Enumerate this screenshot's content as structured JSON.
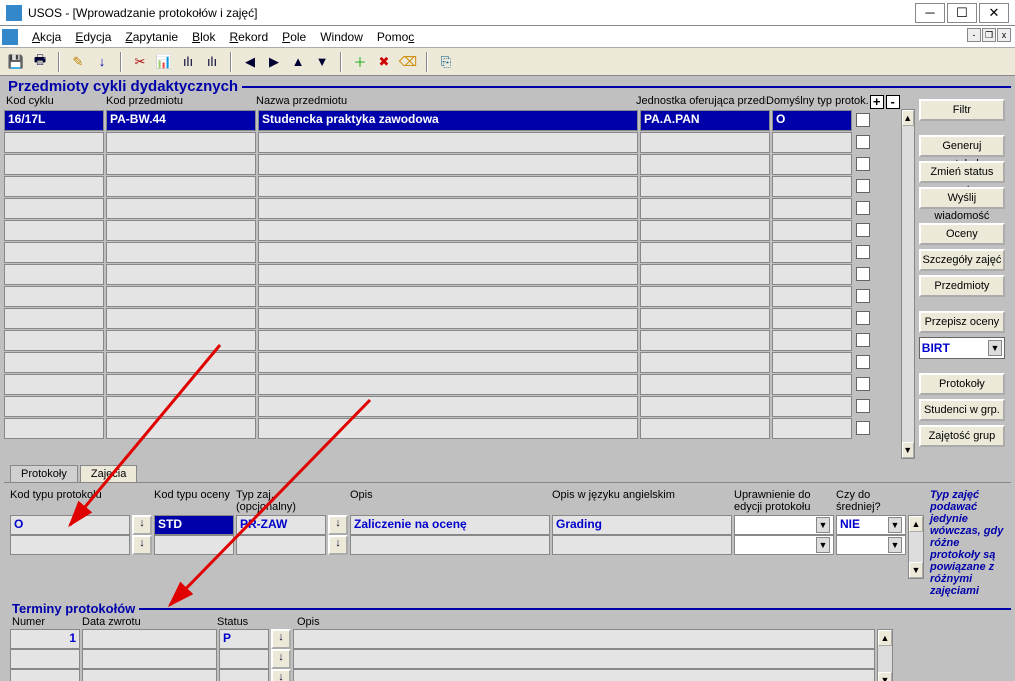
{
  "window": {
    "title": "USOS - [Wprowadzanie protokołów i zajęć]"
  },
  "menu": {
    "a1": "Akcja",
    "a2": "Edycja",
    "a3": "Zapytanie",
    "a4": "Blok",
    "a5": "Rekord",
    "a6": "Pole",
    "a7": "Window",
    "a8": "Pomoc"
  },
  "section1": {
    "title": "Przedmioty cykli dydaktycznych",
    "headers": {
      "c1": "Kod cyklu",
      "c2": "Kod przedmiotu",
      "c3": "Nazwa przedmiotu",
      "c4": "Jednostka oferująca przedm.",
      "c5": "Domyślny typ protok."
    },
    "row1": {
      "c1": "16/17L",
      "c2": "PA-BW.44",
      "c3": "Studencka praktyka zawodowa",
      "c4": "PA.A.PAN",
      "c5": "O"
    }
  },
  "buttons": {
    "b1": "Filtr",
    "b2": "Generuj protokoły",
    "b3": "Zmień status prot.",
    "b4": "Wyślij wiadomość",
    "b5": "Oceny",
    "b6": "Szczegóły zajęć",
    "b7": "Przedmioty",
    "b8": "Przepisz oceny",
    "sel": "BIRT",
    "b9": "Protokoły",
    "b10": "Studenci w grp.",
    "b11": "Zajętość grup"
  },
  "tabs": {
    "t1": "Protokoły",
    "t2": "Zajęcia"
  },
  "proto": {
    "h1": "Kod typu protokołu",
    "h2": "Kod typu oceny",
    "h3": "Typ zaj. (opcjonalny)",
    "h4": "Opis",
    "h5": "Opis w języku angielskim",
    "h6": "Uprawnienie do edycji protokołu",
    "h7": "Czy do średniej?",
    "v1": "O",
    "v2": "STD",
    "v3": "PR-ZAW",
    "v4": "Zaliczenie na ocenę",
    "v5": "Grading",
    "v7": "NIE"
  },
  "note": "Typ zajęć podawać jedynie wówczas, gdy różne protokoły są powiązane z różnymi zajęciami",
  "terms": {
    "title": "Terminy protokołów",
    "h1": "Numer",
    "h2": "Data zwrotu",
    "h3": "Status",
    "h4": "Opis",
    "v1": "1",
    "v3": "P"
  }
}
